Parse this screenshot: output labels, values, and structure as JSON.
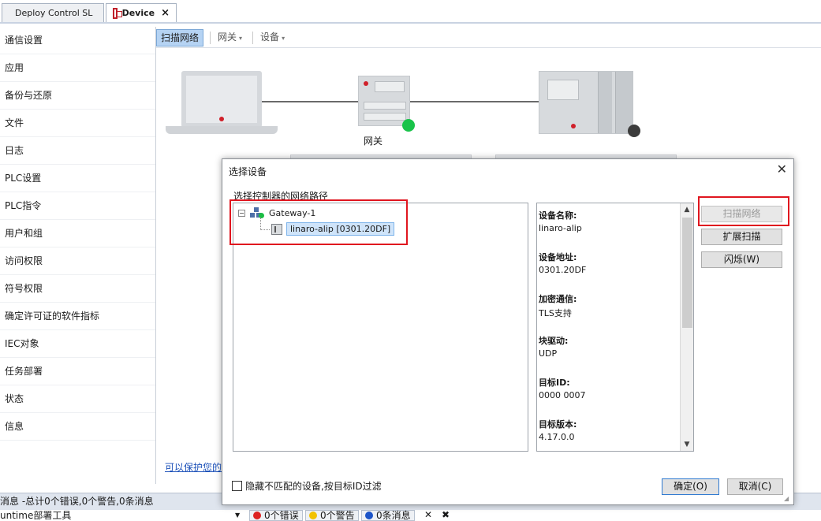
{
  "tabs": [
    {
      "label": "Deploy Control SL"
    },
    {
      "label": "Device",
      "close": "×"
    }
  ],
  "nav": {
    "items": [
      {
        "label": "通信设置"
      },
      {
        "label": "应用"
      },
      {
        "label": "备份与还原"
      },
      {
        "label": "文件"
      },
      {
        "label": "日志"
      },
      {
        "label": "PLC设置"
      },
      {
        "label": "PLC指令"
      },
      {
        "label": "用户和组"
      },
      {
        "label": "访问权限"
      },
      {
        "label": "符号权限"
      },
      {
        "label": "确定许可证的软件指标"
      },
      {
        "label": "IEC对象"
      },
      {
        "label": "任务部署"
      },
      {
        "label": "状态"
      },
      {
        "label": "信息"
      }
    ]
  },
  "toolbar": {
    "scan": "扫描网络",
    "gateway": "网关",
    "device": "设备",
    "caret": "▾"
  },
  "canvas": {
    "gateway_label": "网关",
    "protect_link": "可以保护您的"
  },
  "dialog": {
    "title": "选择设备",
    "close": "✕",
    "subtitle": "选择控制器的网络路径",
    "tree": {
      "root": "Gateway-1",
      "root_expander": "−",
      "child": "linaro-alip [0301.20DF]"
    },
    "info": [
      {
        "label": "设备名称:",
        "value": "linaro-alip"
      },
      {
        "label": "设备地址:",
        "value": "0301.20DF"
      },
      {
        "label": "加密通信:",
        "value": "TLS支持"
      },
      {
        "label": "块驱动:",
        "value": "UDP"
      },
      {
        "label": "目标ID:",
        "value": "0000 0007"
      },
      {
        "label": "目标版本:",
        "value": "4.17.0.0"
      }
    ],
    "scroll_up": "▲",
    "scroll_down": "▼",
    "buttons": {
      "scan_network": "扫描网络",
      "extended_scan": "扩展扫描",
      "wink": "闪烁(W)",
      "ok": "确定(O)",
      "cancel": "取消(C)"
    },
    "filter_checkbox": "隐藏不匹配的设备,按目标ID过滤"
  },
  "messages": {
    "summary": "消息 -总计0个错误,0个警告,0条消息",
    "source": "untime部署工具",
    "errors": "0个错误",
    "warnings": "0个警告",
    "infos": "0条消息"
  },
  "colors": {
    "highlight_red": "#e0161f",
    "selection_blue": "#cfe4fa",
    "online_green": "#19c34a"
  }
}
